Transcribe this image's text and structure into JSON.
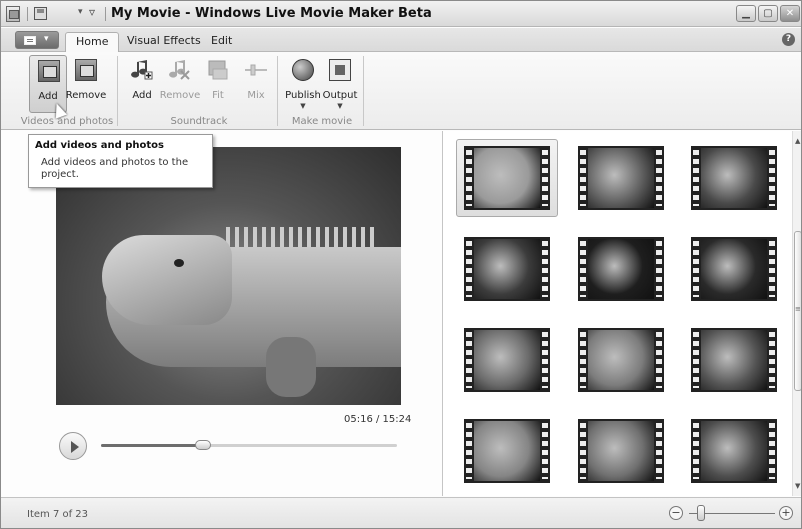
{
  "window": {
    "title": "My Movie - Windows Live Movie Maker Beta",
    "controls": [
      "minimize-icon",
      "maximize-icon",
      "close-icon"
    ]
  },
  "tabs": [
    {
      "label": "Home",
      "active": true
    },
    {
      "label": "Visual Effects",
      "active": false
    },
    {
      "label": "Edit",
      "active": false
    }
  ],
  "ribbon": {
    "groups": [
      {
        "label": "Videos and photos",
        "buttons": [
          {
            "label": "Add",
            "icon": "add-video-icon",
            "enabled": true,
            "pressed": true
          },
          {
            "label": "Remove",
            "icon": "remove-video-icon",
            "enabled": true
          }
        ]
      },
      {
        "label": "Soundtrack",
        "buttons": [
          {
            "label": "Add",
            "icon": "add-music-icon",
            "enabled": true
          },
          {
            "label": "Remove",
            "icon": "remove-music-icon",
            "enabled": false
          },
          {
            "label": "Fit",
            "icon": "fit-icon",
            "enabled": false
          },
          {
            "label": "Mix",
            "icon": "mix-icon",
            "enabled": false
          }
        ]
      },
      {
        "label": "Make movie",
        "buttons": [
          {
            "label": "Publish",
            "icon": "publish-icon",
            "enabled": true,
            "dropdown": true
          },
          {
            "label": "Output",
            "icon": "output-icon",
            "enabled": true,
            "dropdown": true
          }
        ]
      }
    ]
  },
  "tooltip": {
    "title": "Add videos and photos",
    "body": "Add videos and photos to the project."
  },
  "preview": {
    "timecode": "05:16 / 15:24",
    "progress_fraction": 0.345
  },
  "storyboard": {
    "selected_index": 0,
    "thumbnails": [
      {
        "tone": "#9a9a9a"
      },
      {
        "tone": "#5e5e5e"
      },
      {
        "tone": "#4a4a4a"
      },
      {
        "tone": "#3c3c3c"
      },
      {
        "tone": "#1e1e1e"
      },
      {
        "tone": "#2a2a2a"
      },
      {
        "tone": "#6a6a6a"
      },
      {
        "tone": "#7c7c7c"
      },
      {
        "tone": "#555555"
      },
      {
        "tone": "#858585"
      },
      {
        "tone": "#707070"
      },
      {
        "tone": "#4e4e4e"
      }
    ]
  },
  "status": {
    "text": "Item 7 of 23",
    "zoom_minus": "−",
    "zoom_plus": "+"
  }
}
